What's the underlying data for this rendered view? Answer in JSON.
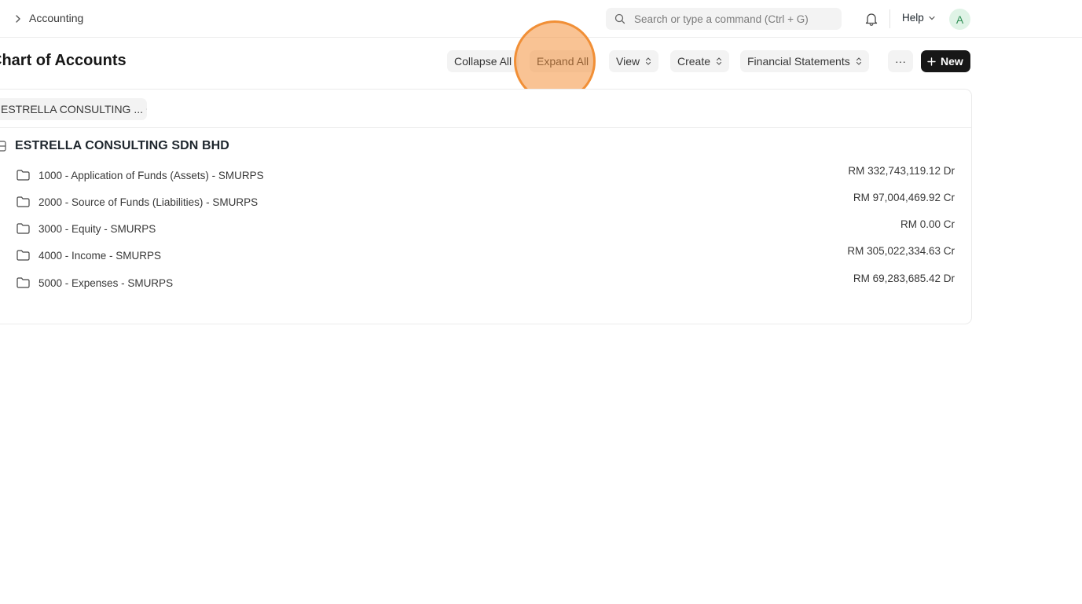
{
  "topbar": {
    "breadcrumb": "Accounting",
    "search_placeholder": "Search or type a command (Ctrl + G)",
    "help_label": "Help",
    "avatar_initial": "A"
  },
  "page": {
    "title": "Chart of Accounts"
  },
  "toolbar": {
    "collapse_all": "Collapse All",
    "expand_all": "Expand All",
    "view": "View",
    "create": "Create",
    "financial_statements": "Financial Statements",
    "more": "···",
    "new": "New"
  },
  "filter": {
    "company": "ESTRELLA CONSULTING ..."
  },
  "tree": {
    "root": "ESTRELLA CONSULTING SDN BHD",
    "accounts": [
      {
        "name": "1000 - Application of Funds (Assets) - SMURPS",
        "balance": "RM 332,743,119.12 Dr"
      },
      {
        "name": "2000 - Source of Funds (Liabilities) - SMURPS",
        "balance": "RM 97,004,469.92 Cr"
      },
      {
        "name": "3000 - Equity - SMURPS",
        "balance": "RM 0.00 Cr"
      },
      {
        "name": "4000 - Income - SMURPS",
        "balance": "RM 305,022,334.63 Cr"
      },
      {
        "name": "5000 - Expenses - SMURPS",
        "balance": "RM 69,283,685.42 Dr"
      }
    ]
  },
  "colors": {
    "primary_button": "#171717",
    "button_bg": "#f3f3f3",
    "avatar_bg": "#dff3e6",
    "cursor_highlight": "#f4923c"
  }
}
